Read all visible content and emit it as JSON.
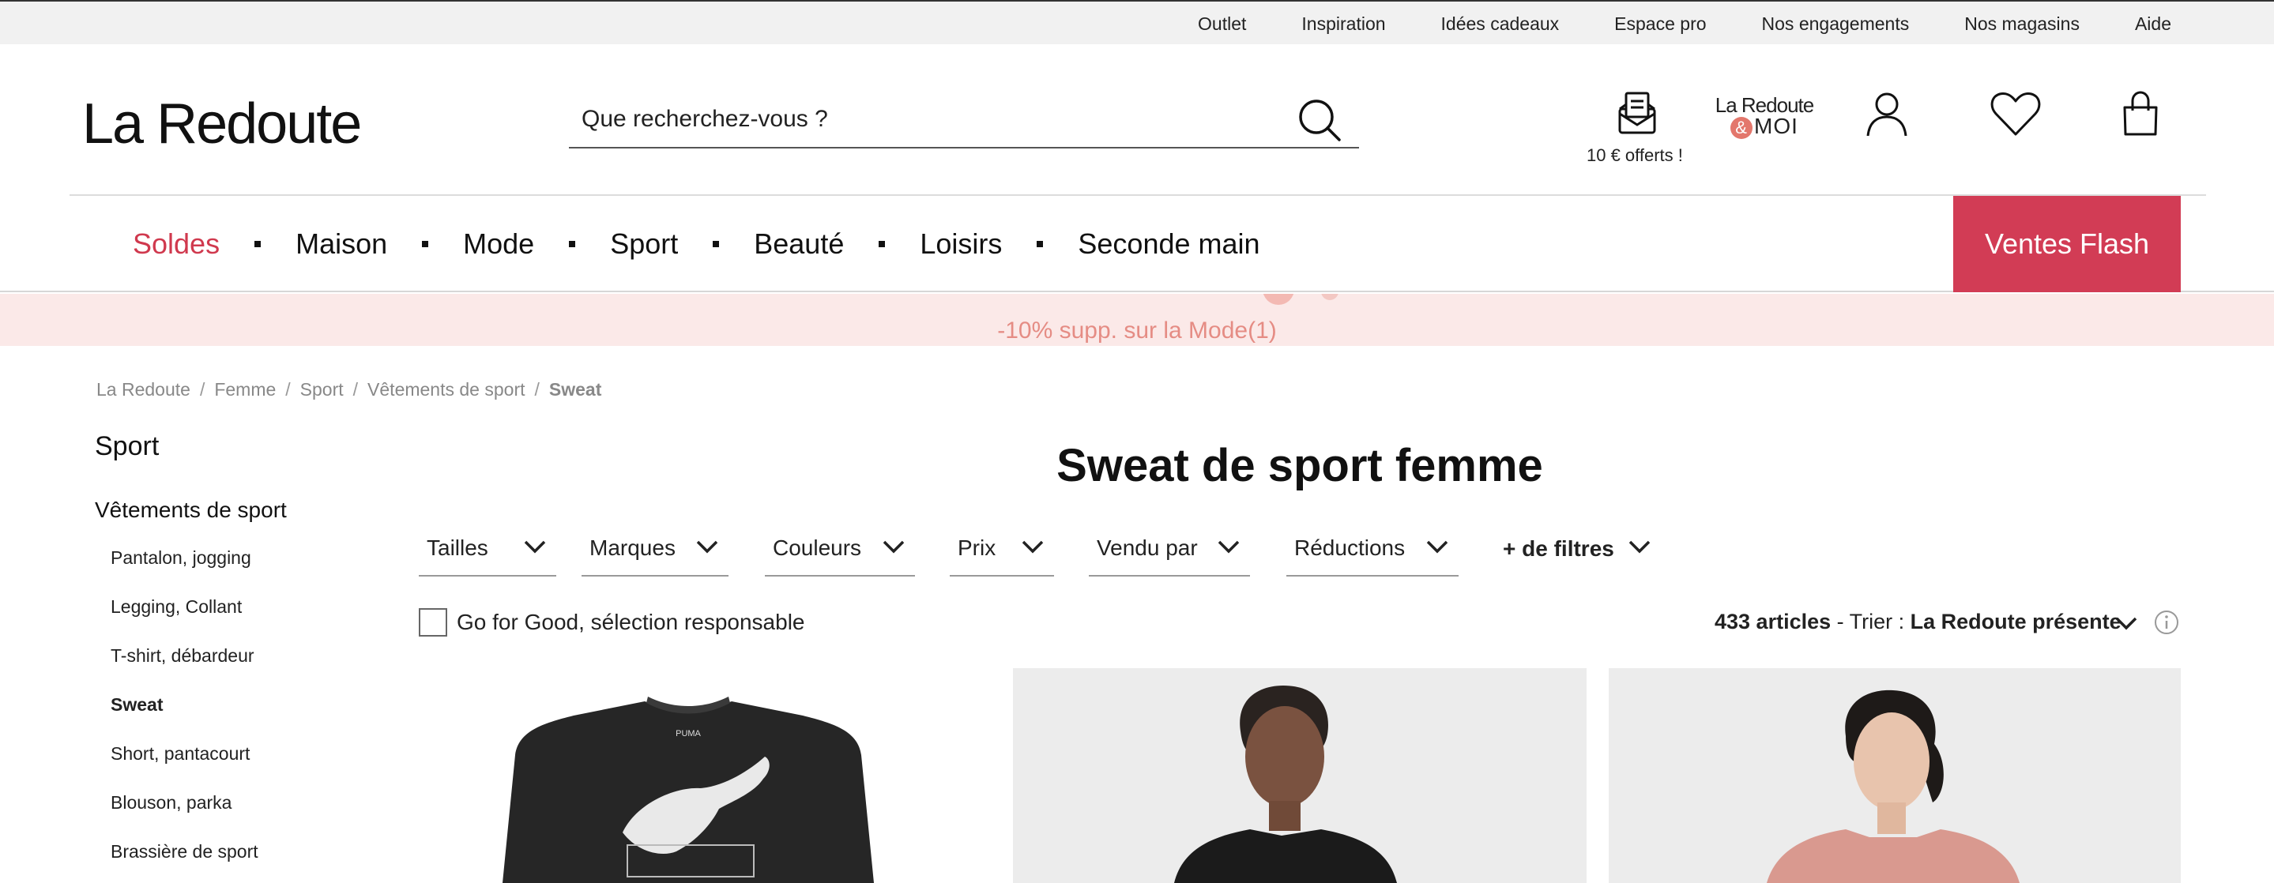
{
  "topbar": {
    "links": [
      "Outlet",
      "Inspiration",
      "Idées cadeaux",
      "Espace pro",
      "Nos engagements",
      "Nos magasins",
      "Aide"
    ]
  },
  "header": {
    "logo": "La Redoute",
    "search_placeholder": "Que recherchez-vous ?",
    "offer_text": "10 € offerts !",
    "loyalty_line1": "La Redoute",
    "loyalty_amp": "&",
    "loyalty_line2": "MOI"
  },
  "nav": {
    "items": [
      "Soldes",
      "Maison",
      "Mode",
      "Sport",
      "Beauté",
      "Loisirs",
      "Seconde main"
    ],
    "flash": "Ventes Flash",
    "accent_color": "#d0394e",
    "flash_color": "#d23c55"
  },
  "promo": {
    "text": "-10% supp. sur la Mode(1)"
  },
  "breadcrumb": [
    "La Redoute",
    "Femme",
    "Sport",
    "Vêtements de sport",
    "Sweat"
  ],
  "sidebar": {
    "title": "Sport",
    "subtitle": "Vêtements de sport",
    "items": [
      "Pantalon, jogging",
      "Legging, Collant",
      "T-shirt, débardeur",
      "Sweat",
      "Short, pantacourt",
      "Blouson, parka",
      "Brassière de sport"
    ],
    "active": "Sweat"
  },
  "page": {
    "title": "Sweat de sport femme"
  },
  "filters": [
    "Tailles",
    "Marques",
    "Couleurs",
    "Prix",
    "Vendu par",
    "Réductions",
    "+ de filtres"
  ],
  "options": {
    "checkbox_label": "Go for Good, sélection responsable",
    "count": "433 articles",
    "sort_prefix": " - Trier : ",
    "sort_value": "La Redoute présente"
  },
  "products": [
    {
      "brand_print": "PUMA",
      "color": "black"
    },
    {
      "color": "black"
    },
    {
      "color": "pink"
    }
  ]
}
